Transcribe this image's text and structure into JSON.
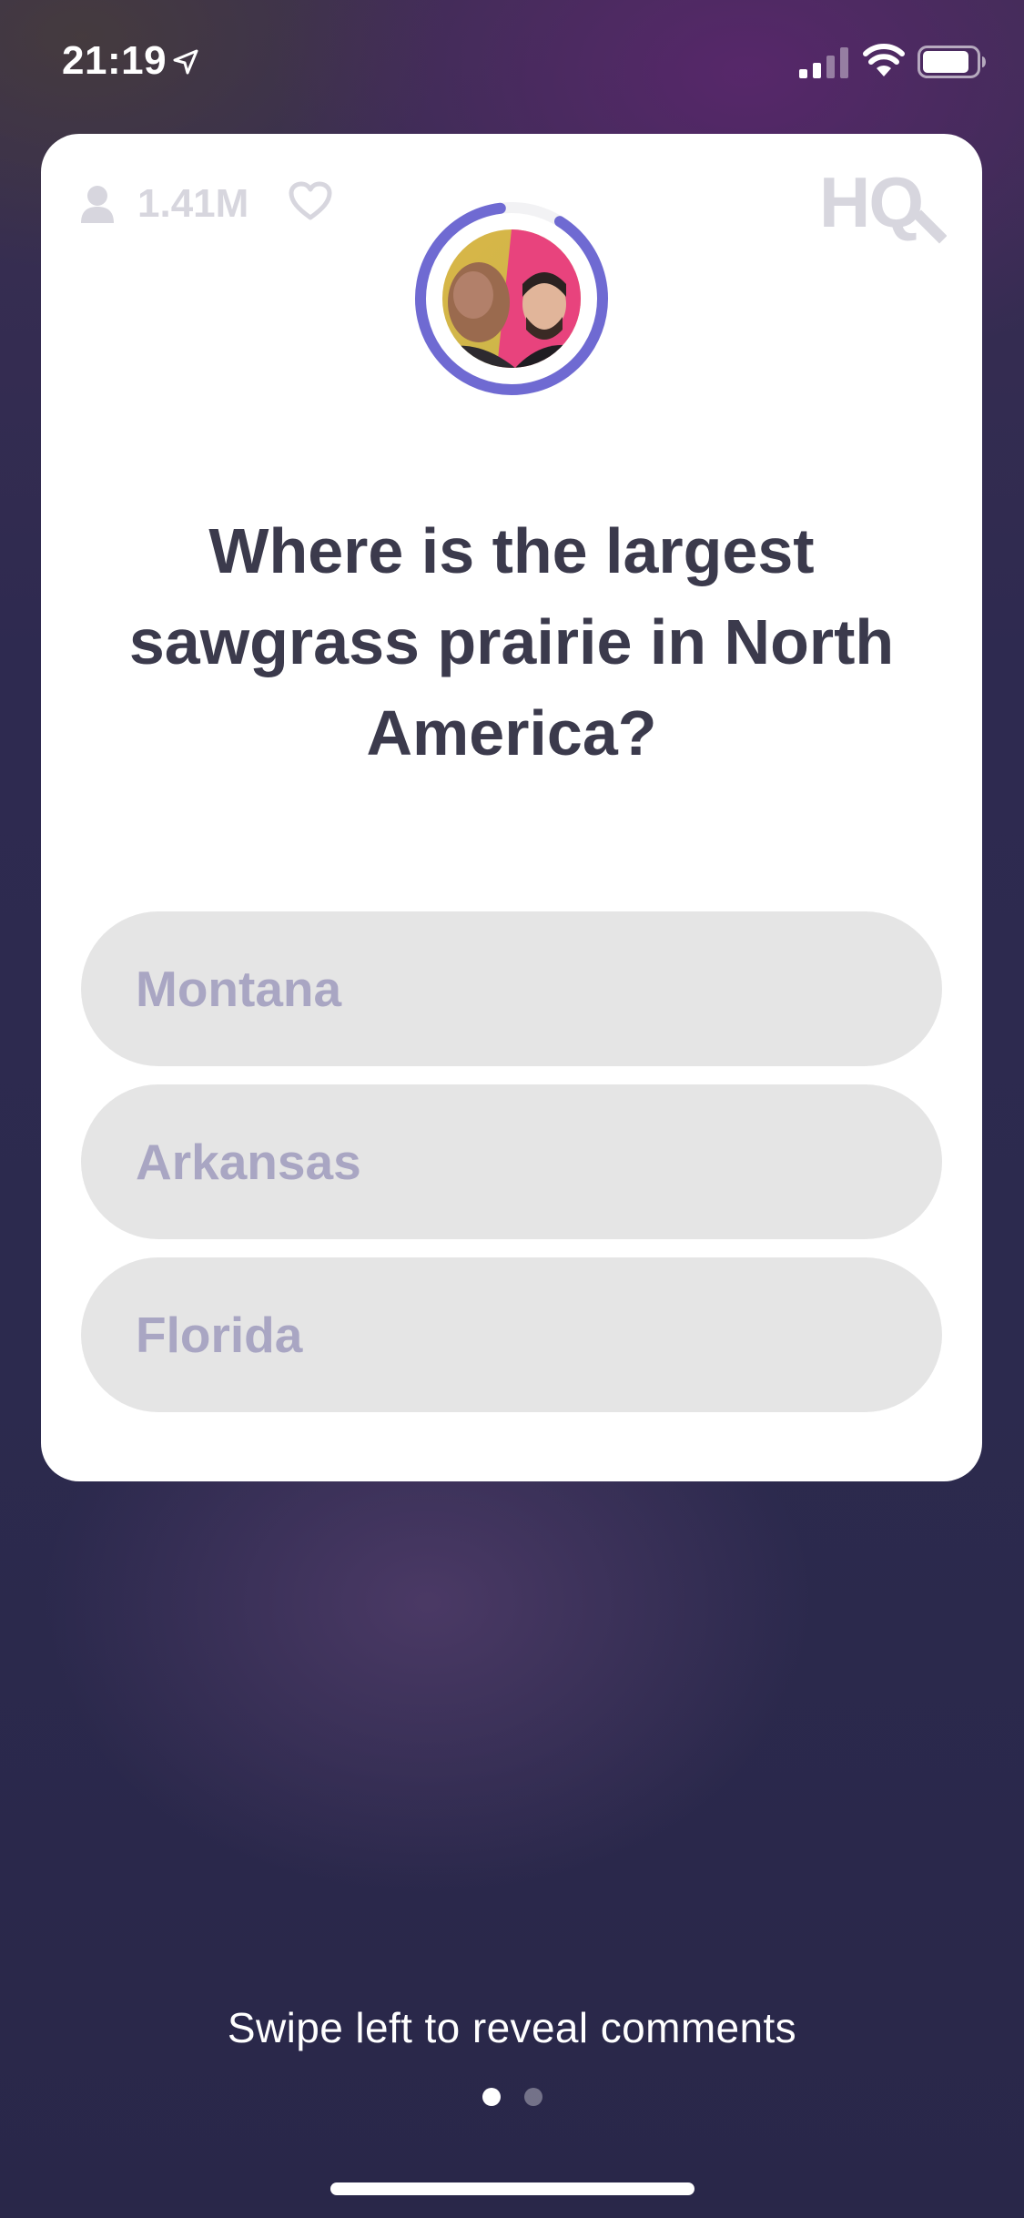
{
  "status_bar": {
    "time": "21:19",
    "icons": [
      "location-arrow-icon",
      "cellular-signal-icon",
      "wifi-icon",
      "battery-icon"
    ]
  },
  "header": {
    "viewer_count": "1.41M",
    "viewer_icon": "person-icon",
    "like_icon": "heart-icon",
    "logo": "HQ",
    "timer_color": "#6f6ad2"
  },
  "question": {
    "text": "Where is the largest sawgrass prairie in North America?"
  },
  "answers": [
    {
      "label": "Montana"
    },
    {
      "label": "Arkansas"
    },
    {
      "label": "Florida"
    }
  ],
  "footer": {
    "swipe_hint": "Swipe left to reveal comments",
    "pages": 2,
    "current_page": 1
  },
  "colors": {
    "answer_bg": "#e5e5e5",
    "answer_text": "#a9a6c3",
    "question_text": "#3b3a4c",
    "muted_header": "#d7d6de"
  }
}
